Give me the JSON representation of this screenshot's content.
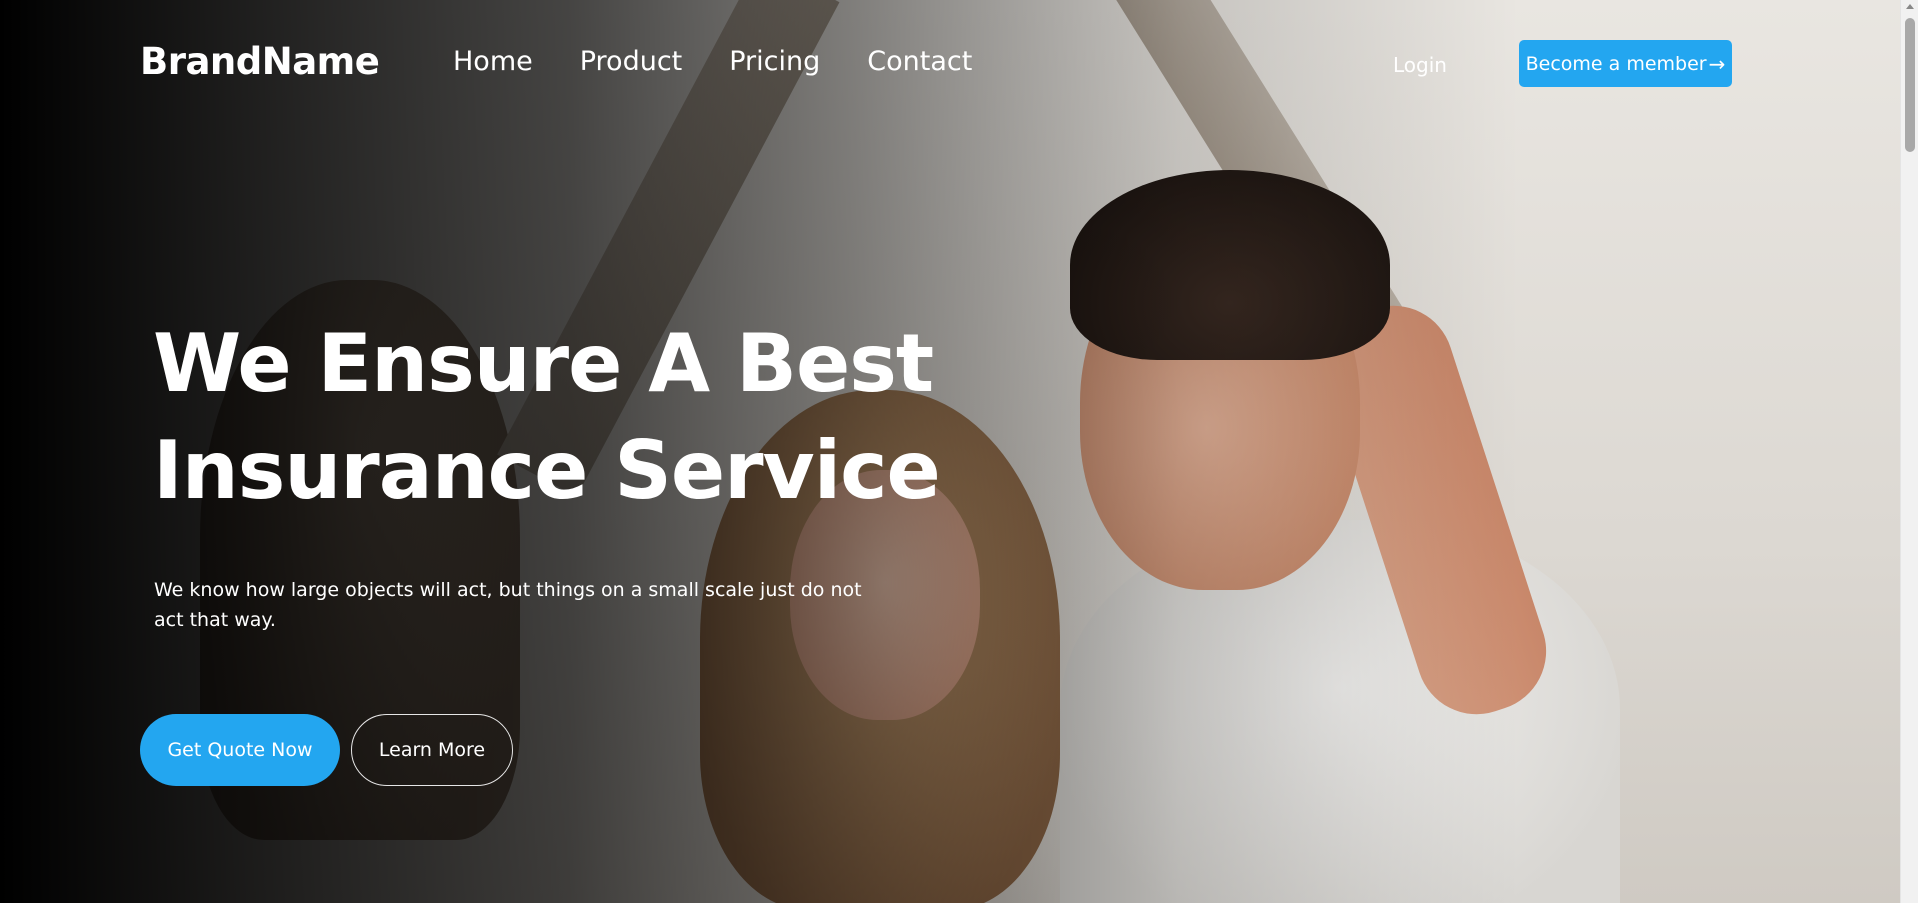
{
  "nav": {
    "brand": "BrandName",
    "links": [
      "Home",
      "Product",
      "Pricing",
      "Contact"
    ],
    "login": "Login",
    "member_button": "Become a member",
    "member_button_icon": "arrow-right-icon"
  },
  "hero": {
    "title_line1": "We Ensure A Best",
    "title_line2": "Insurance Service",
    "subtitle": "We know how large objects will act, but things on a small scale just do not act that way.",
    "primary_cta": "Get Quote Now",
    "secondary_cta": "Learn More",
    "background_image": "family under cardboard roof photo"
  },
  "colors": {
    "accent": "#23a6f0",
    "text": "#ffffff",
    "overlay": "#000000"
  }
}
